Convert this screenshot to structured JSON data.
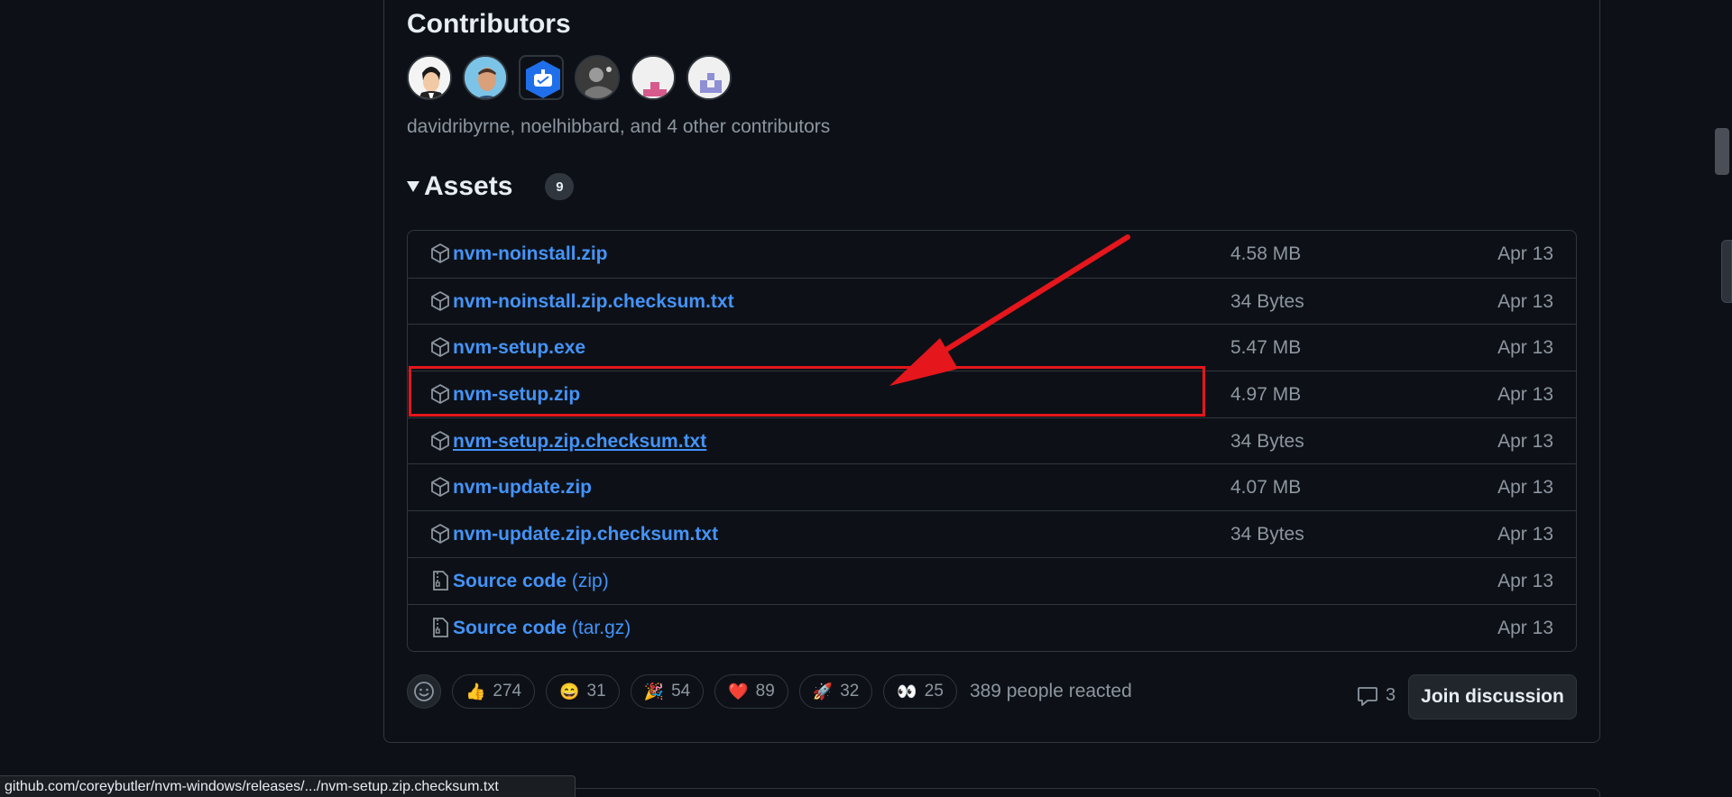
{
  "contributors": {
    "title": "Contributors",
    "summary": "davidribyrne, noelhibbard, and 4 other contributors"
  },
  "assets": {
    "title": "Assets",
    "count": "9",
    "items": [
      {
        "name": "nvm-noinstall.zip",
        "size": "4.58 MB",
        "date": "Apr 13",
        "icon": "package-icon"
      },
      {
        "name": "nvm-noinstall.zip.checksum.txt",
        "size": "34 Bytes",
        "date": "Apr 13",
        "icon": "package-icon"
      },
      {
        "name": "nvm-setup.exe",
        "size": "5.47 MB",
        "date": "Apr 13",
        "icon": "package-icon"
      },
      {
        "name": "nvm-setup.zip",
        "size": "4.97 MB",
        "date": "Apr 13",
        "icon": "package-icon"
      },
      {
        "name": "nvm-setup.zip.checksum.txt",
        "size": "34 Bytes",
        "date": "Apr 13",
        "icon": "package-icon"
      },
      {
        "name": "nvm-update.zip",
        "size": "4.07 MB",
        "date": "Apr 13",
        "icon": "package-icon"
      },
      {
        "name": "nvm-update.zip.checksum.txt",
        "size": "34 Bytes",
        "date": "Apr 13",
        "icon": "package-icon"
      },
      {
        "name": "Source code",
        "suffix": "(zip)",
        "size": "",
        "date": "Apr 13",
        "icon": "file-zip-icon"
      },
      {
        "name": "Source code",
        "suffix": "(tar.gz)",
        "size": "",
        "date": "Apr 13",
        "icon": "file-zip-icon"
      }
    ]
  },
  "reactions": {
    "items": [
      {
        "emoji": "👍",
        "count": "274",
        "icon": "thumbs-up-icon"
      },
      {
        "emoji": "😄",
        "count": "31",
        "icon": "laugh-icon"
      },
      {
        "emoji": "🎉",
        "count": "54",
        "icon": "hooray-icon"
      },
      {
        "emoji": "❤️",
        "count": "89",
        "icon": "heart-icon"
      },
      {
        "emoji": "🚀",
        "count": "32",
        "icon": "rocket-icon"
      },
      {
        "emoji": "👀",
        "count": "25",
        "icon": "eyes-icon"
      }
    ],
    "summary": "389 people reacted"
  },
  "discussion": {
    "comment_count": "3",
    "join_label": "Join discussion"
  },
  "statusbar": {
    "url": "github.com/coreybutler/nvm-windows/releases/.../nvm-setup.zip.checksum.txt"
  },
  "colors": {
    "background": "#0d1117",
    "link": "#4493f8",
    "muted": "#8d96a0",
    "annotation": "#e5161c"
  }
}
